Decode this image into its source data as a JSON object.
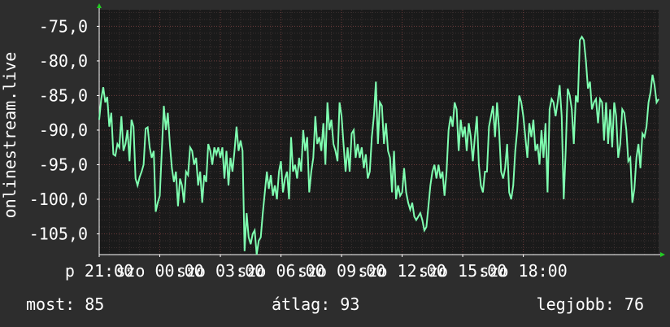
{
  "chart_data": {
    "type": "line",
    "ylabel": "onlinestream.live",
    "ylim": [
      -108,
      -72.6
    ],
    "yticks": [
      -75,
      -80,
      -85,
      -90,
      -95,
      -100,
      -105
    ],
    "ytick_labels": [
      "-75,0",
      "-80,0",
      "-85,0",
      "-90,0",
      "-95,0",
      "-100,0",
      "-105,0"
    ],
    "xlim": [
      0,
      23.7
    ],
    "xticks": [
      0,
      3,
      6,
      9,
      12,
      15,
      18,
      21
    ],
    "xtick_labels": [
      "p 21:00",
      "szo 00:00",
      "szo 03:00",
      "szo 06:00",
      "szo 09:00",
      "szo 12:00",
      "szo 15:00",
      "szo 18:00"
    ],
    "grid": true,
    "colors": {
      "line": "#7fffb0",
      "grid": "#6a3a3a",
      "axis": "#ffffff",
      "arrow": "#22cc22",
      "plot_bg": "#1a1a1a"
    },
    "series": [
      {
        "values": [
          [
            0.0,
            -88.5
          ],
          [
            0.1,
            -85.5
          ],
          [
            0.2,
            -83.8
          ],
          [
            0.3,
            -86
          ],
          [
            0.4,
            -85.2
          ],
          [
            0.5,
            -89.5
          ],
          [
            0.6,
            -87.5
          ],
          [
            0.7,
            -93.5
          ],
          [
            0.8,
            -93.7
          ],
          [
            0.9,
            -92
          ],
          [
            1.0,
            -92.5
          ],
          [
            1.1,
            -88
          ],
          [
            1.2,
            -93
          ],
          [
            1.3,
            -92
          ],
          [
            1.4,
            -90
          ],
          [
            1.5,
            -94.5
          ],
          [
            1.6,
            -88.5
          ],
          [
            1.7,
            -89.5
          ],
          [
            1.8,
            -97
          ],
          [
            1.9,
            -98
          ],
          [
            2.0,
            -96.8
          ],
          [
            2.1,
            -96
          ],
          [
            2.2,
            -95
          ],
          [
            2.3,
            -89.8
          ],
          [
            2.4,
            -89.6
          ],
          [
            2.5,
            -92.5
          ],
          [
            2.6,
            -94
          ],
          [
            2.7,
            -93
          ],
          [
            2.8,
            -101.8
          ],
          [
            2.9,
            -100.5
          ],
          [
            3.0,
            -99.5
          ],
          [
            3.1,
            -93
          ],
          [
            3.2,
            -86.5
          ],
          [
            3.3,
            -90
          ],
          [
            3.4,
            -87.5
          ],
          [
            3.5,
            -92
          ],
          [
            3.6,
            -95.5
          ],
          [
            3.7,
            -97.5
          ],
          [
            3.8,
            -96
          ],
          [
            3.9,
            -101
          ],
          [
            4.0,
            -97
          ],
          [
            4.1,
            -98
          ],
          [
            4.2,
            -100.5
          ],
          [
            4.3,
            -96
          ],
          [
            4.4,
            -96.5
          ],
          [
            4.5,
            -92.5
          ],
          [
            4.6,
            -93
          ],
          [
            4.7,
            -95
          ],
          [
            4.8,
            -94
          ],
          [
            4.9,
            -98
          ],
          [
            5.0,
            -96
          ],
          [
            5.1,
            -100.5
          ],
          [
            5.2,
            -96.5
          ],
          [
            5.3,
            -97.5
          ],
          [
            5.4,
            -92
          ],
          [
            5.5,
            -93
          ],
          [
            5.6,
            -95
          ],
          [
            5.7,
            -92.5
          ],
          [
            5.8,
            -93.5
          ],
          [
            5.9,
            -92.5
          ],
          [
            6.0,
            -94
          ],
          [
            6.1,
            -92.5
          ],
          [
            6.2,
            -97
          ],
          [
            6.3,
            -93
          ],
          [
            6.4,
            -98
          ],
          [
            6.5,
            -94
          ],
          [
            6.6,
            -96
          ],
          [
            6.7,
            -93
          ],
          [
            6.8,
            -89.5
          ],
          [
            6.9,
            -93
          ],
          [
            7.0,
            -91.5
          ],
          [
            7.1,
            -93
          ],
          [
            7.2,
            -107.5
          ],
          [
            7.3,
            -102
          ],
          [
            7.4,
            -105.5
          ],
          [
            7.5,
            -106.5
          ],
          [
            7.6,
            -105
          ],
          [
            7.7,
            -104.5
          ],
          [
            7.8,
            -108
          ],
          [
            7.9,
            -106
          ],
          [
            8.0,
            -105.5
          ],
          [
            8.1,
            -102
          ],
          [
            8.2,
            -99
          ],
          [
            8.3,
            -96
          ],
          [
            8.4,
            -98.5
          ],
          [
            8.5,
            -96.5
          ],
          [
            8.6,
            -99.5
          ],
          [
            8.7,
            -98
          ],
          [
            8.8,
            -100
          ],
          [
            8.9,
            -96
          ],
          [
            9.0,
            -94.5
          ],
          [
            9.1,
            -99
          ],
          [
            9.2,
            -97
          ],
          [
            9.3,
            -96
          ],
          [
            9.4,
            -100
          ],
          [
            9.5,
            -91
          ],
          [
            9.6,
            -96
          ],
          [
            9.7,
            -95
          ],
          [
            9.8,
            -97
          ],
          [
            9.9,
            -94
          ],
          [
            10.0,
            -96
          ],
          [
            10.1,
            -90
          ],
          [
            10.2,
            -93
          ],
          [
            10.3,
            -91
          ],
          [
            10.4,
            -99
          ],
          [
            10.5,
            -96
          ],
          [
            10.6,
            -94
          ],
          [
            10.7,
            -88
          ],
          [
            10.8,
            -92
          ],
          [
            10.9,
            -91
          ],
          [
            11.0,
            -93
          ],
          [
            11.1,
            -89
          ],
          [
            11.2,
            -95
          ],
          [
            11.3,
            -86
          ],
          [
            11.4,
            -90
          ],
          [
            11.5,
            -88.5
          ],
          [
            11.6,
            -92
          ],
          [
            11.7,
            -93
          ],
          [
            11.8,
            -94.5
          ],
          [
            11.9,
            -86
          ],
          [
            12.0,
            -88
          ],
          [
            12.1,
            -92
          ],
          [
            12.2,
            -96
          ],
          [
            12.3,
            -92.5
          ],
          [
            12.4,
            -96
          ],
          [
            12.5,
            -90.5
          ],
          [
            12.6,
            -90
          ],
          [
            12.7,
            -94
          ],
          [
            12.8,
            -92
          ],
          [
            12.9,
            -94
          ],
          [
            13.0,
            -92.5
          ],
          [
            13.1,
            -95.5
          ],
          [
            13.2,
            -93.5
          ],
          [
            13.3,
            -97
          ],
          [
            13.4,
            -96
          ],
          [
            13.5,
            -91
          ],
          [
            13.6,
            -88
          ],
          [
            13.7,
            -83
          ],
          [
            13.8,
            -92
          ],
          [
            13.9,
            -86
          ],
          [
            14.0,
            -86.5
          ],
          [
            14.1,
            -92
          ],
          [
            14.2,
            -89
          ],
          [
            14.3,
            -93
          ],
          [
            14.4,
            -94
          ],
          [
            14.5,
            -99
          ],
          [
            14.6,
            -93
          ],
          [
            14.7,
            -100
          ],
          [
            14.8,
            -98
          ],
          [
            14.9,
            -99.5
          ],
          [
            15.0,
            -99
          ],
          [
            15.1,
            -95.5
          ],
          [
            15.2,
            -99
          ],
          [
            15.3,
            -100.5
          ],
          [
            15.4,
            -101.5
          ],
          [
            15.5,
            -100.5
          ],
          [
            15.6,
            -102.5
          ],
          [
            15.7,
            -103
          ],
          [
            15.8,
            -102.5
          ],
          [
            15.9,
            -102
          ],
          [
            16.0,
            -103
          ],
          [
            16.1,
            -104.5
          ],
          [
            16.2,
            -104
          ],
          [
            16.3,
            -101
          ],
          [
            16.4,
            -98
          ],
          [
            16.5,
            -96
          ],
          [
            16.6,
            -95
          ],
          [
            16.7,
            -97
          ],
          [
            16.8,
            -95
          ],
          [
            16.9,
            -97
          ],
          [
            17.0,
            -96
          ],
          [
            17.1,
            -99.5
          ],
          [
            17.2,
            -96
          ],
          [
            17.3,
            -90
          ],
          [
            17.4,
            -88
          ],
          [
            17.5,
            -89.5
          ],
          [
            17.6,
            -86
          ],
          [
            17.7,
            -87
          ],
          [
            17.8,
            -93
          ],
          [
            17.9,
            -88.5
          ],
          [
            18.0,
            -91
          ],
          [
            18.1,
            -89.5
          ],
          [
            18.2,
            -93
          ],
          [
            18.3,
            -89
          ],
          [
            18.4,
            -91
          ],
          [
            18.5,
            -94.5
          ],
          [
            18.6,
            -91
          ],
          [
            18.7,
            -88
          ],
          [
            18.8,
            -95
          ],
          [
            18.9,
            -98
          ],
          [
            19.0,
            -99
          ],
          [
            19.1,
            -96
          ],
          [
            19.2,
            -96
          ],
          [
            19.3,
            -89.5
          ],
          [
            19.4,
            -88
          ],
          [
            19.5,
            -86.5
          ],
          [
            19.6,
            -91
          ],
          [
            19.7,
            -86
          ],
          [
            19.8,
            -90
          ],
          [
            19.9,
            -96
          ],
          [
            20.0,
            -97
          ],
          [
            20.1,
            -95.5
          ],
          [
            20.2,
            -92
          ],
          [
            20.3,
            -99
          ],
          [
            20.4,
            -100
          ],
          [
            20.5,
            -98
          ],
          [
            20.6,
            -93
          ],
          [
            20.7,
            -90
          ],
          [
            20.8,
            -85
          ],
          [
            20.9,
            -86
          ],
          [
            21.0,
            -88
          ],
          [
            21.1,
            -91
          ],
          [
            21.2,
            -94
          ],
          [
            21.3,
            -89
          ],
          [
            21.4,
            -91
          ],
          [
            21.5,
            -88.5
          ],
          [
            21.6,
            -93
          ],
          [
            21.7,
            -92
          ],
          [
            21.8,
            -95
          ],
          [
            21.9,
            -90
          ],
          [
            22.0,
            -94
          ],
          [
            22.1,
            -89
          ],
          [
            22.2,
            -99
          ],
          [
            22.3,
            -87
          ],
          [
            22.4,
            -85.5
          ],
          [
            22.5,
            -86
          ],
          [
            22.6,
            -88
          ],
          [
            22.7,
            -86
          ],
          [
            22.8,
            -83.5
          ],
          [
            22.9,
            -88
          ],
          [
            23.0,
            -100
          ],
          [
            23.1,
            -93
          ],
          [
            23.2,
            -84
          ],
          [
            23.3,
            -85
          ],
          [
            23.4,
            -87
          ],
          [
            23.5,
            -92
          ],
          [
            23.6,
            -85
          ],
          [
            23.7,
            -86
          ],
          [
            23.8,
            -77
          ],
          [
            23.9,
            -76.5
          ],
          [
            24.0,
            -77
          ],
          [
            24.1,
            -80
          ],
          [
            24.2,
            -84
          ],
          [
            24.3,
            -83
          ],
          [
            24.4,
            -87
          ],
          [
            24.5,
            -86
          ],
          [
            24.6,
            -85.5
          ],
          [
            24.7,
            -89
          ],
          [
            24.8,
            -85.5
          ],
          [
            24.9,
            -86
          ],
          [
            25.0,
            -91.5
          ],
          [
            25.1,
            -86
          ],
          [
            25.2,
            -92
          ],
          [
            25.3,
            -87
          ],
          [
            25.4,
            -92.5
          ],
          [
            25.5,
            -86
          ],
          [
            25.6,
            -88
          ],
          [
            25.7,
            -94
          ],
          [
            25.8,
            -92
          ],
          [
            25.9,
            -87
          ],
          [
            26.0,
            -87.5
          ],
          [
            26.1,
            -90
          ],
          [
            26.2,
            -94.5
          ],
          [
            26.3,
            -94
          ],
          [
            26.4,
            -100.5
          ],
          [
            26.5,
            -98.5
          ],
          [
            26.6,
            -94
          ],
          [
            26.7,
            -92
          ],
          [
            26.8,
            -95.5
          ],
          [
            26.9,
            -90.5
          ],
          [
            27.0,
            -91
          ],
          [
            27.1,
            -89.5
          ],
          [
            27.2,
            -86
          ],
          [
            27.3,
            -84.5
          ],
          [
            27.4,
            -82
          ],
          [
            27.5,
            -83.5
          ],
          [
            27.6,
            -86
          ],
          [
            27.7,
            -85.5
          ]
        ]
      }
    ]
  },
  "stats": {
    "now": "most: 85",
    "avg": "átlag: 93",
    "best": "legjobb: 76"
  }
}
